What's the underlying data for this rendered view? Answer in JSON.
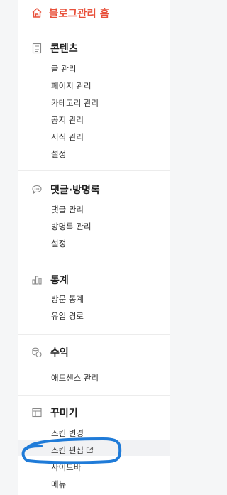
{
  "home": {
    "label": "블로그관리 홈",
    "icon": "home-icon",
    "color": "#e8503a"
  },
  "sections": [
    {
      "id": "content",
      "title": "콘텐츠",
      "icon": "document-icon",
      "items": [
        "글 관리",
        "페이지 관리",
        "카테고리 관리",
        "공지 관리",
        "서식 관리",
        "설정"
      ]
    },
    {
      "id": "comments",
      "title": "댓글·방명록",
      "icon": "speech-bubble-icon",
      "items": [
        "댓글 관리",
        "방명록 관리",
        "설정"
      ]
    },
    {
      "id": "stats",
      "title": "통계",
      "icon": "bar-chart-icon",
      "items": [
        "방문 통계",
        "유입 경로"
      ]
    },
    {
      "id": "revenue",
      "title": "수익",
      "icon": "coins-icon",
      "items": [
        "애드센스 관리"
      ]
    },
    {
      "id": "design",
      "title": "꾸미기",
      "icon": "layout-icon",
      "items": [
        "스킨 변경",
        "스킨 편집",
        "사이드바",
        "메뉴"
      ]
    }
  ],
  "annotation_color": "#1f7bd8"
}
